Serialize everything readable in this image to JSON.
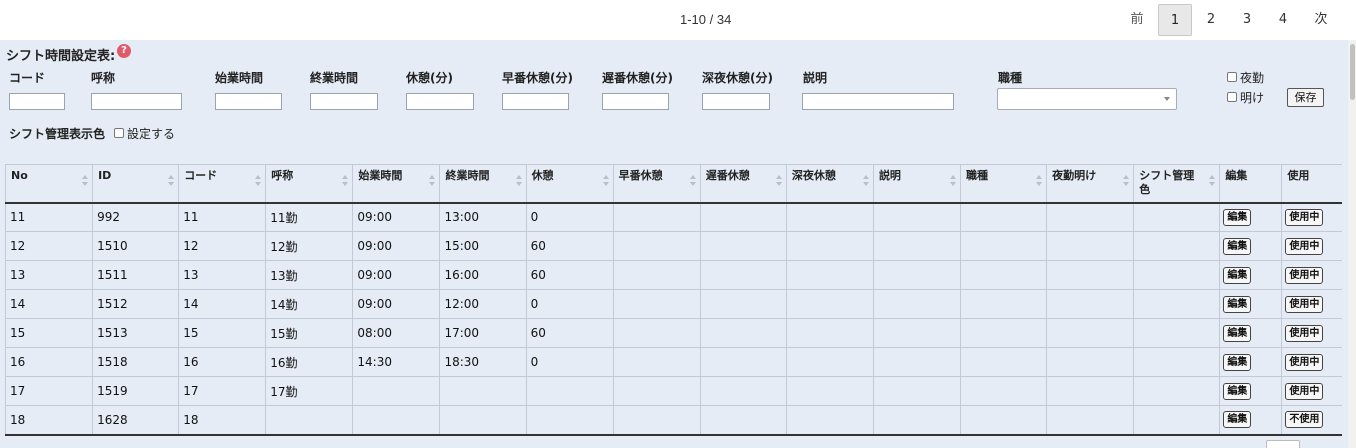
{
  "pagination": {
    "range": "1-10 / 34",
    "prev": "前",
    "current": "1",
    "pages": [
      "2",
      "3",
      "4"
    ],
    "next": "次"
  },
  "form": {
    "title": "シフト時間設定表:",
    "help_icon": "?",
    "labels": {
      "code": "コード",
      "name": "呼称",
      "start": "始業時間",
      "end": "終業時間",
      "break": "休憩(分)",
      "early_break": "早番休憩(分)",
      "late_break": "遅番休憩(分)",
      "night_break": "深夜休憩(分)",
      "desc": "説明",
      "job": "職種"
    },
    "values": {
      "code": "",
      "name": "",
      "start": "",
      "end": "",
      "break": "",
      "early_break": "",
      "late_break": "",
      "night_break": "",
      "desc": "",
      "job": ""
    },
    "night_shift_label": "夜勤",
    "after_night_label": "明け",
    "save_label": "保存",
    "color_label": "シフト管理表示色",
    "color_setting_label": "設定する"
  },
  "table": {
    "headers": [
      "No",
      "ID",
      "コード",
      "呼称",
      "始業時間",
      "終業時間",
      "休憩",
      "早番休憩",
      "遅番休憩",
      "深夜休憩",
      "説明",
      "職種",
      "夜勤明け",
      "シフト管理色",
      "編集",
      "使用"
    ],
    "edit_label": "編集",
    "rows": [
      {
        "no": "11",
        "id": "992",
        "code": "11",
        "name": "11勤",
        "start": "09:00",
        "end": "13:00",
        "break": "0",
        "use": "使用中"
      },
      {
        "no": "12",
        "id": "1510",
        "code": "12",
        "name": "12勤",
        "start": "09:00",
        "end": "15:00",
        "break": "60",
        "use": "使用中"
      },
      {
        "no": "13",
        "id": "1511",
        "code": "13",
        "name": "13勤",
        "start": "09:00",
        "end": "16:00",
        "break": "60",
        "use": "使用中"
      },
      {
        "no": "14",
        "id": "1512",
        "code": "14",
        "name": "14勤",
        "start": "09:00",
        "end": "12:00",
        "break": "0",
        "use": "使用中"
      },
      {
        "no": "15",
        "id": "1513",
        "code": "15",
        "name": "15勤",
        "start": "08:00",
        "end": "17:00",
        "break": "60",
        "use": "使用中"
      },
      {
        "no": "16",
        "id": "1518",
        "code": "16",
        "name": "16勤",
        "start": "14:30",
        "end": "18:30",
        "break": "0",
        "use": "使用中"
      },
      {
        "no": "17",
        "id": "1519",
        "code": "17",
        "name": "17勤",
        "start": "",
        "end": "",
        "break": "",
        "use": "使用中"
      },
      {
        "no": "18",
        "id": "1628",
        "code": "18",
        "name": "",
        "start": "",
        "end": "",
        "break": "",
        "use": "不使用"
      }
    ]
  }
}
